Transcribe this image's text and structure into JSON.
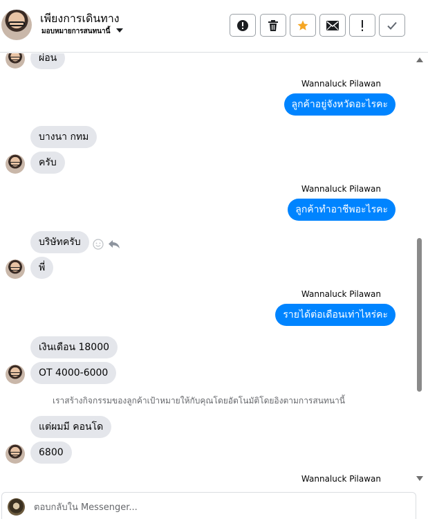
{
  "header": {
    "title": "เพียงการเดินทาง",
    "subtitle": "มอบหมายการสนทนานี้",
    "actions": [
      {
        "name": "report-button",
        "icon": "alert-circle-icon"
      },
      {
        "name": "delete-button",
        "icon": "trash-icon"
      },
      {
        "name": "star-button",
        "icon": "star-icon",
        "color": "#f5a623"
      },
      {
        "name": "mark-unread-button",
        "icon": "envelope-icon"
      },
      {
        "name": "important-button",
        "icon": "exclamation-icon"
      },
      {
        "name": "mark-done-button",
        "icon": "checkmark-icon"
      }
    ]
  },
  "messages": {
    "m1": "ผ่อน",
    "name1": "Wannaluck Pilawan",
    "m2": "ลูกค้าอยู่จังหวัดอะไรคะ",
    "m3": "บางนา กทม",
    "m4": "ครับ",
    "name2": "Wannaluck Pilawan",
    "m5": "ลูกค้าทำอาชีพอะไรคะ",
    "m6": "บริษัทครับ",
    "m7": "พี่",
    "name3": "Wannaluck Pilawan",
    "m8": "รายได้ต่อเดือนเท่าไหร่คะ",
    "m9": "เงินเดือน 18000",
    "m10": "OT 4000-6000",
    "notice": "เราสร้างกิจกรรมของลูกค้าเป้าหมายให้กับคุณโดยอัตโนมัติโดยอิงตามการสนทนานี้",
    "m11": "แต่ผมมี คอนโด",
    "m12": "6800",
    "name4": "Wannaluck Pilawan"
  },
  "composer": {
    "placeholder": "ตอบกลับใน Messenger..."
  },
  "colors": {
    "outgoing_bubble": "#0084ff",
    "incoming_bubble": "#e4e6eb",
    "star": "#f5a623"
  }
}
